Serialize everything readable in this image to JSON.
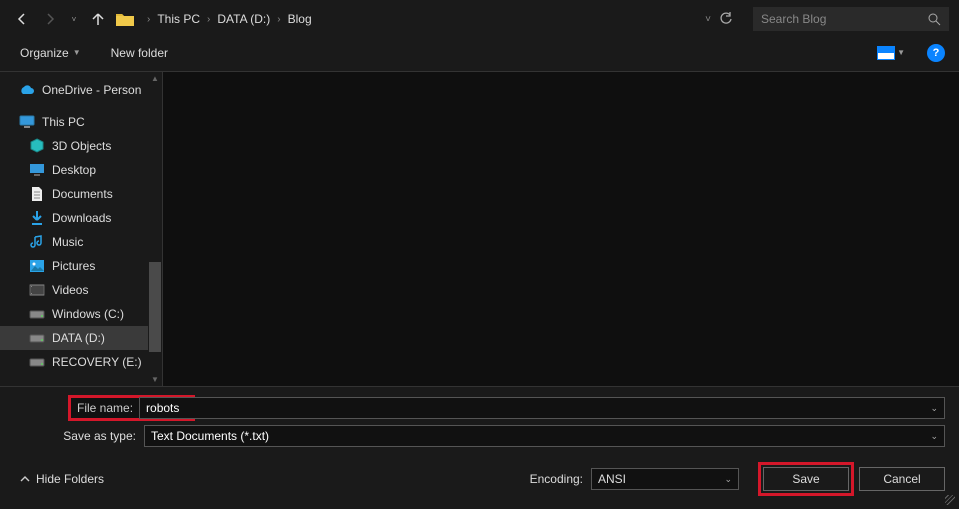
{
  "nav": {
    "breadcrumb": [
      "This PC",
      "DATA (D:)",
      "Blog"
    ],
    "search_placeholder": "Search Blog"
  },
  "toolbar": {
    "organize": "Organize",
    "new_folder": "New folder"
  },
  "tree": {
    "items": [
      {
        "label": "OneDrive - Person",
        "icon": "cloud",
        "level": 0
      },
      {
        "label": "This PC",
        "icon": "pc",
        "level": 0
      },
      {
        "label": "3D Objects",
        "icon": "cube",
        "level": 1
      },
      {
        "label": "Desktop",
        "icon": "desktop",
        "level": 1
      },
      {
        "label": "Documents",
        "icon": "doc",
        "level": 1
      },
      {
        "label": "Downloads",
        "icon": "download",
        "level": 1
      },
      {
        "label": "Music",
        "icon": "music",
        "level": 1
      },
      {
        "label": "Pictures",
        "icon": "picture",
        "level": 1
      },
      {
        "label": "Videos",
        "icon": "video",
        "level": 1
      },
      {
        "label": "Windows (C:)",
        "icon": "drive",
        "level": 1
      },
      {
        "label": "DATA (D:)",
        "icon": "drive",
        "level": 1,
        "selected": true
      },
      {
        "label": "RECOVERY (E:)",
        "icon": "drive",
        "level": 1
      }
    ]
  },
  "fields": {
    "filename_label": "File name:",
    "filename_value": "robots",
    "savetype_label": "Save as type:",
    "savetype_value": "Text Documents (*.txt)"
  },
  "actions": {
    "hide_folders": "Hide Folders",
    "encoding_label": "Encoding:",
    "encoding_value": "ANSI",
    "save": "Save",
    "cancel": "Cancel"
  }
}
